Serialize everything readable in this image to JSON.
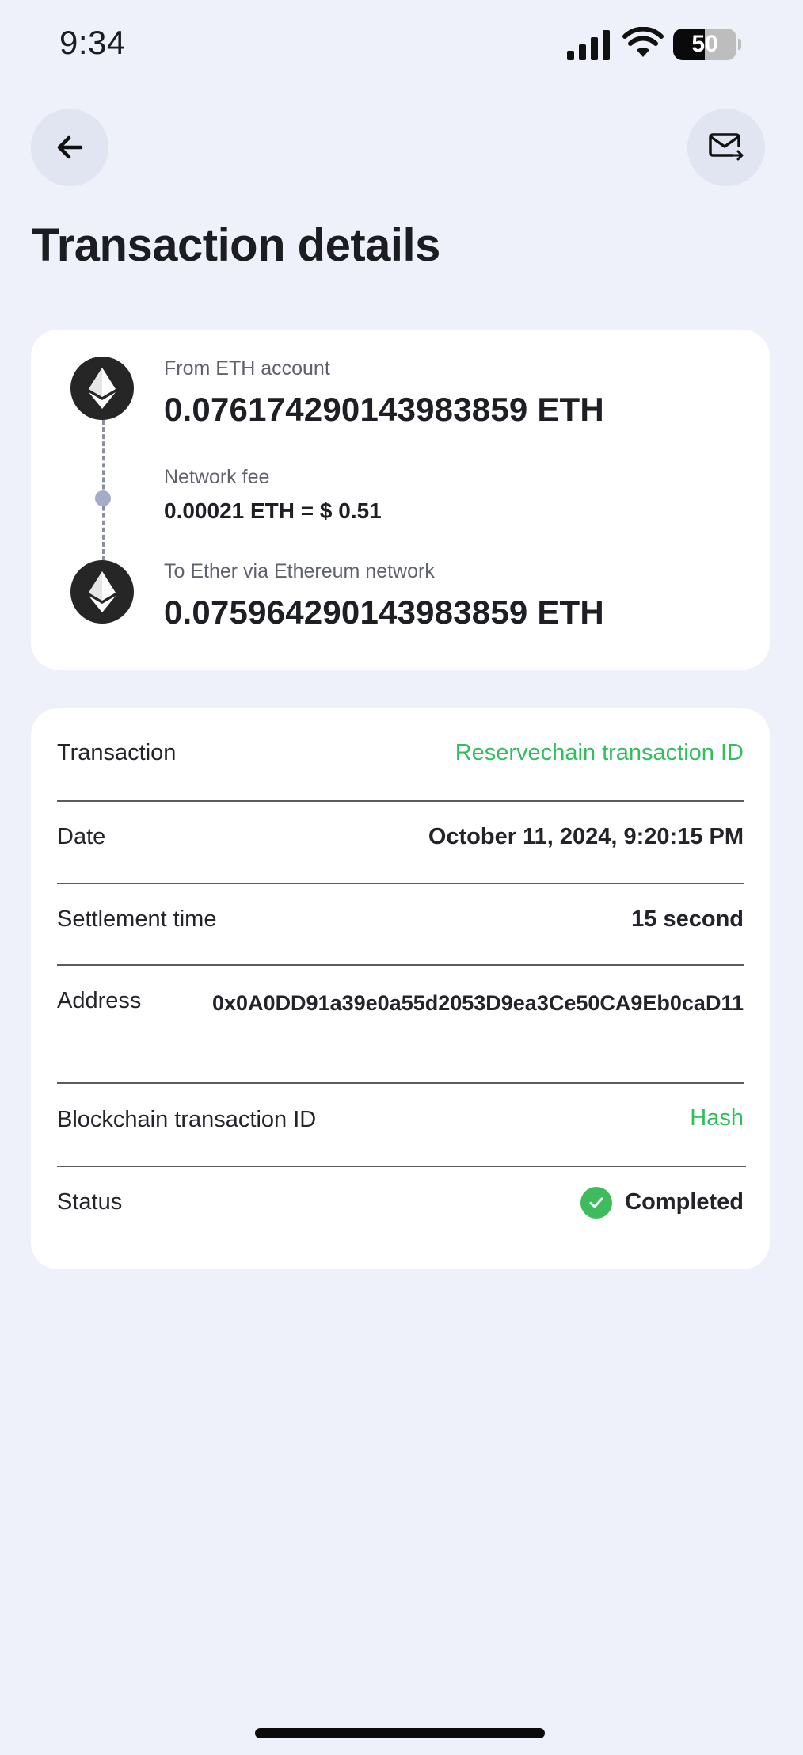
{
  "status_bar": {
    "time": "9:34",
    "battery_level": "50",
    "battery_fraction": 0.5,
    "icons": [
      "signal-icon",
      "wifi-icon",
      "battery-icon"
    ]
  },
  "nav": {
    "back_icon": "arrow-left-icon",
    "mail_icon": "mail-send-icon"
  },
  "title": "Transaction details",
  "flow": {
    "from_label": "From ETH account",
    "from_amount": "0.076174290143983859 ETH",
    "fee_label": "Network fee",
    "fee_value": "0.00021 ETH = $ 0.51",
    "to_label": "To Ether via Ethereum network",
    "to_amount": "0.075964290143983859 ETH",
    "icon": "ethereum-icon"
  },
  "details": {
    "transaction_label": "Transaction",
    "transaction_value": "Reservechain transaction ID",
    "date_label": "Date",
    "date_value": "October 11, 2024, 9:20:15 PM",
    "settlement_label": "Settlement time",
    "settlement_value": "15 second",
    "address_label": "Address",
    "address_value": "0x0A0DD91a39e0a55d2053D9ea3Ce50CA9Eb0caD11",
    "blockchain_label": "Blockchain transaction ID",
    "blockchain_value": "Hash",
    "status_label": "Status",
    "status_value": "Completed"
  },
  "colors": {
    "background": "#eef1f9",
    "card": "#ffffff",
    "accent_green": "#2fbf5c",
    "status_green": "#3dbb5d",
    "fee_dot": "#a5acc8"
  }
}
